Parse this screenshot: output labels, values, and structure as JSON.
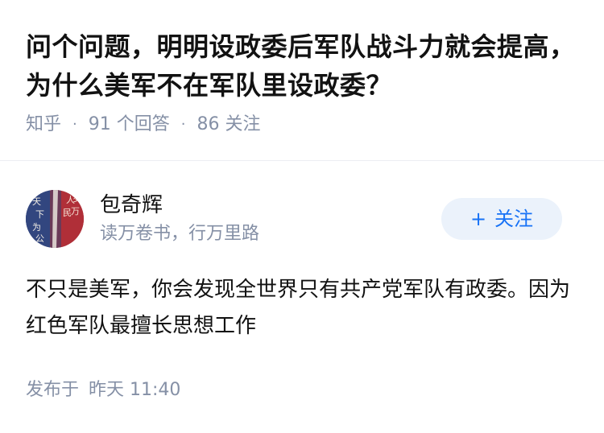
{
  "question": {
    "title": "问个问题，明明设政委后军队战斗力就会提高，为什么美军不在军队里设政委？",
    "source": "知乎",
    "answers": "91 个回答",
    "followers": "86 关注"
  },
  "author": {
    "name": "包奇辉",
    "bio": "读万卷书，行万里路",
    "avatar_text_left": "天下为公",
    "avatar_text_right": "人民万岁",
    "follow_label": "关注",
    "follow_icon": "plus-icon"
  },
  "answer": {
    "text": "不只是美军，你会发现全世界只有共产党军队有政委。因为红色军队最擅长思想工作"
  },
  "footer": {
    "posted_label": "发布于",
    "posted_time": "昨天 11:40"
  },
  "colors": {
    "accent": "#1772f6",
    "button_bg": "#ebf2fb",
    "meta_text": "#8590a6",
    "main_text": "#121212"
  }
}
